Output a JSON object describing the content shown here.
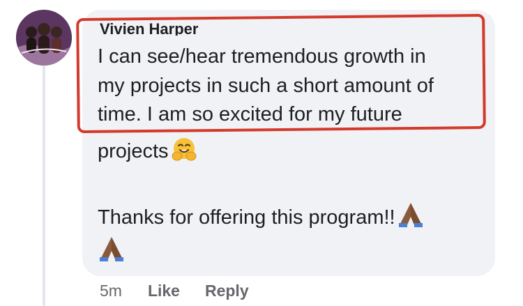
{
  "comment": {
    "author": "Vivien Harper",
    "lines": [
      "I can see/hear tremendous growth in",
      "my projects in such a short amount of",
      "time.  I am so excited for my future",
      "projects",
      "Thanks for offering this program!!"
    ],
    "emoji": {
      "after_line_4": "hugging-face-icon",
      "after_line_5": "folded-hands-icon",
      "standalone": "folded-hands-icon"
    }
  },
  "actions": {
    "time": "5m",
    "like_label": "Like",
    "reply_label": "Reply"
  },
  "colors": {
    "bubble": "#f0f2f5",
    "text": "#1c1e21",
    "meta": "#65676b",
    "annotation": "#d33a2c"
  }
}
